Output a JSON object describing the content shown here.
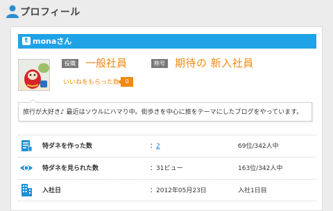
{
  "header": {
    "title": "プロフィール",
    "icon": "person-icon"
  },
  "user": {
    "name": "monaさん",
    "icon": "twitter-icon"
  },
  "profile": {
    "role_tag": "役職",
    "role_value": "一般社員",
    "title_tag": "称号",
    "title_value": "期待の 新入社員",
    "likes_label": "いいねをもらった数",
    "likes_count": "0"
  },
  "bio": "旅行が大好き♪ 最近はソウルにハマり中。街歩きを中心に旅をテーマにしたブログをやっています。",
  "stats": [
    {
      "icon": "document-icon",
      "label": "特ダネを作った数",
      "prefix": "：",
      "value": "2",
      "rank": "69位/342人中"
    },
    {
      "icon": "eye-icon",
      "label": "特ダネを見られた数",
      "value": "：31ビュー",
      "rank": "163位/342人中"
    },
    {
      "icon": "building-icon",
      "label": "入社日",
      "value": "：2012年05月23日",
      "rank": "入社1日目"
    }
  ],
  "colors": {
    "accent": "#1fa3e6",
    "orange": "#ef8a12",
    "tag_gray": "#7a7a7a"
  }
}
